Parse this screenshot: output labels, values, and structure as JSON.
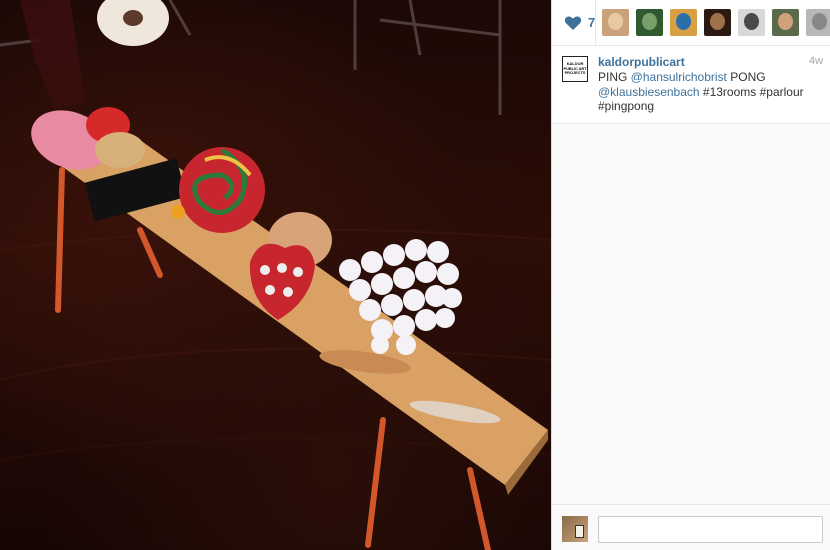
{
  "photo": {
    "icon": "photo-of-pingpong-paddles-on-wooden-bench"
  },
  "likes": {
    "count": "7",
    "icon": "heart-icon",
    "color": "#3f729b"
  },
  "likers": [
    {
      "name": "liker-1",
      "bg": "#c9a27a",
      "face": "#e8c9a0"
    },
    {
      "name": "liker-2",
      "bg": "#2f5a2f",
      "face": "#7aa06a"
    },
    {
      "name": "liker-3",
      "bg": "#d9a043",
      "face": "#2b6fa8"
    },
    {
      "name": "liker-4",
      "bg": "#2b1a12",
      "face": "#a0714a"
    },
    {
      "name": "liker-5",
      "bg": "#d8d8d8",
      "face": "#4a4a4a"
    },
    {
      "name": "liker-6",
      "bg": "#5a6a4a",
      "face": "#cfa27a"
    },
    {
      "name": "liker-7",
      "bg": "#b8b8b8",
      "face": "#888888"
    }
  ],
  "caption": {
    "username": "kaldorpublicart",
    "avatar_text": "KALDOR PUBLIC ART PROJECTS",
    "time": "4w",
    "parts": {
      "p1": "PING ",
      "m1": "@hansulrichobrist",
      "p2": " PONG ",
      "m2": "@klausbiesenbach",
      "p3": " #13rooms #parlour #pingpong"
    }
  },
  "comment": {
    "placeholder": "",
    "value": ""
  }
}
